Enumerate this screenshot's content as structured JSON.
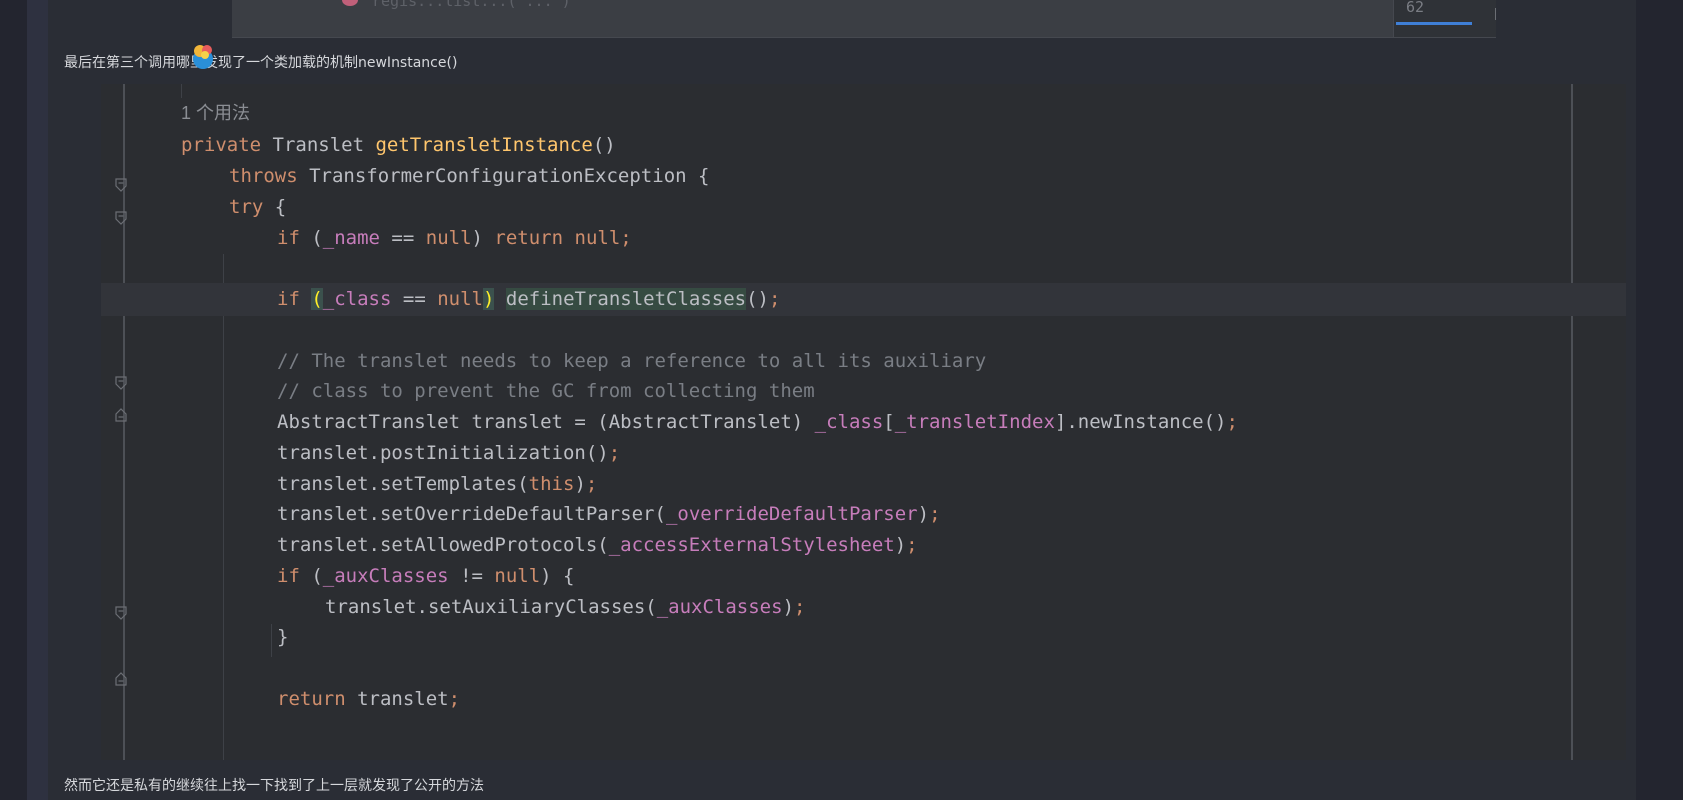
{
  "top_fragment": {
    "faded_text": "regis...list...( ... )",
    "minimap_number": "62"
  },
  "paragraphs": {
    "first": "最后在第三个调用哪里发现了一个类加载的机制newInstance()",
    "second": "然而它还是私有的继续往上找一下找到了上一层就发现了公开的方法"
  },
  "code": {
    "usage_hint": "1 个用法",
    "lines": [
      {
        "t": "private Translet getTransletInstance()"
      },
      {
        "t": "throws TransformerConfigurationException {"
      },
      {
        "t": "try {"
      },
      {
        "t": "if (_name == null) return null;"
      },
      {
        "t": ""
      },
      {
        "t": "if (_class == null) defineTransletClasses();"
      },
      {
        "t": ""
      },
      {
        "t": "// The translet needs to keep a reference to all its auxiliary"
      },
      {
        "t": "// class to prevent the GC from collecting them"
      },
      {
        "t": "AbstractTranslet translet = (AbstractTranslet) _class[_transletIndex].newInstance();"
      },
      {
        "t": "translet.postInitialization();"
      },
      {
        "t": "translet.setTemplates(this);"
      },
      {
        "t": "translet.setOverrideDefaultParser(_overrideDefaultParser);"
      },
      {
        "t": "translet.setAllowedProtocols(_accessExternalStylesheet);"
      },
      {
        "t": "if (_auxClasses != null) {"
      },
      {
        "t": "translet.setAuxiliaryClasses(_auxClasses);"
      },
      {
        "t": "}"
      },
      {
        "t": ""
      },
      {
        "t": "return translet;"
      }
    ]
  },
  "colors": {
    "keyword": "#cf8e6d",
    "method_decl": "#ffc66d",
    "field": "#c77dbb",
    "comment": "#7a7e85",
    "text": "#bcbec4",
    "background": "#2b2d31"
  }
}
